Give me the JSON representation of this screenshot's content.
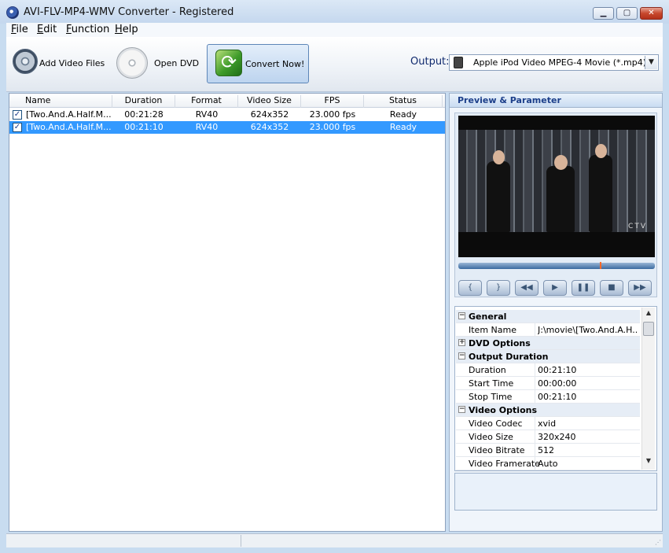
{
  "window": {
    "title": "AVI-FLV-MP4-WMV Converter - Registered",
    "minimize_icon": "minimize-icon",
    "maximize_icon": "maximize-icon",
    "close_icon": "close-icon"
  },
  "menu": {
    "items": [
      {
        "label": "File",
        "mnemonic": "F",
        "rest": "ile"
      },
      {
        "label": "Edit",
        "mnemonic": "E",
        "rest": "dit"
      },
      {
        "label": "Function",
        "mnemonic": "F",
        "rest": "unction"
      },
      {
        "label": "Help",
        "mnemonic": "H",
        "rest": "elp"
      }
    ]
  },
  "toolbar": {
    "add_video_label": "Add Video Files",
    "open_dvd_label": "Open DVD",
    "convert_label": "Convert Now!",
    "output_label": "Output:",
    "output_value": "Apple iPod Video MPEG-4 Movie (*.mp4)"
  },
  "file_list": {
    "columns": [
      "Name",
      "Duration",
      "Format",
      "Video Size",
      "FPS",
      "Status"
    ],
    "rows": [
      {
        "checked": true,
        "name": "[Two.And.A.Half.M...",
        "duration": "00:21:28",
        "format": "RV40",
        "video_size": "624x352",
        "fps": "23.000 fps",
        "status": "Ready",
        "selected": false
      },
      {
        "checked": true,
        "name": "[Two.And.A.Half.M...",
        "duration": "00:21:10",
        "format": "RV40",
        "video_size": "624x352",
        "fps": "23.000 fps",
        "status": "Ready",
        "selected": true
      }
    ]
  },
  "preview": {
    "panel_title": "Preview & Parameter",
    "watermark": "CTV",
    "seek_position_fraction": 0.72,
    "controls": [
      {
        "name": "mark-in-button",
        "icon": "{"
      },
      {
        "name": "mark-out-button",
        "icon": "}"
      },
      {
        "name": "rewind-button",
        "icon": "◀◀"
      },
      {
        "name": "play-button",
        "icon": "▶"
      },
      {
        "name": "pause-button",
        "icon": "❚❚"
      },
      {
        "name": "stop-button",
        "icon": "■"
      },
      {
        "name": "fast-forward-button",
        "icon": "▶▶"
      }
    ]
  },
  "properties": {
    "rows": [
      {
        "type": "category",
        "toggle": "−",
        "name": "General"
      },
      {
        "type": "item",
        "name": "Item Name",
        "value": "J:\\movie\\[Two.And.A.H..."
      },
      {
        "type": "category",
        "toggle": "+",
        "name": "DVD Options"
      },
      {
        "type": "category",
        "toggle": "−",
        "name": "Output Duration"
      },
      {
        "type": "item",
        "name": "Duration",
        "value": "00:21:10"
      },
      {
        "type": "item",
        "name": "Start Time",
        "value": "00:00:00"
      },
      {
        "type": "item",
        "name": "Stop Time",
        "value": "00:21:10"
      },
      {
        "type": "category",
        "toggle": "−",
        "name": "Video Options"
      },
      {
        "type": "item",
        "name": "Video Codec",
        "value": "xvid"
      },
      {
        "type": "item",
        "name": "Video Size",
        "value": "320x240"
      },
      {
        "type": "item",
        "name": "Video Bitrate",
        "value": "512"
      },
      {
        "type": "item",
        "name": "Video Framerate",
        "value": "Auto"
      }
    ]
  },
  "colors": {
    "selection": "#3399ff",
    "panel_title": "#1c3f8a",
    "close_button": "#c7482d"
  }
}
